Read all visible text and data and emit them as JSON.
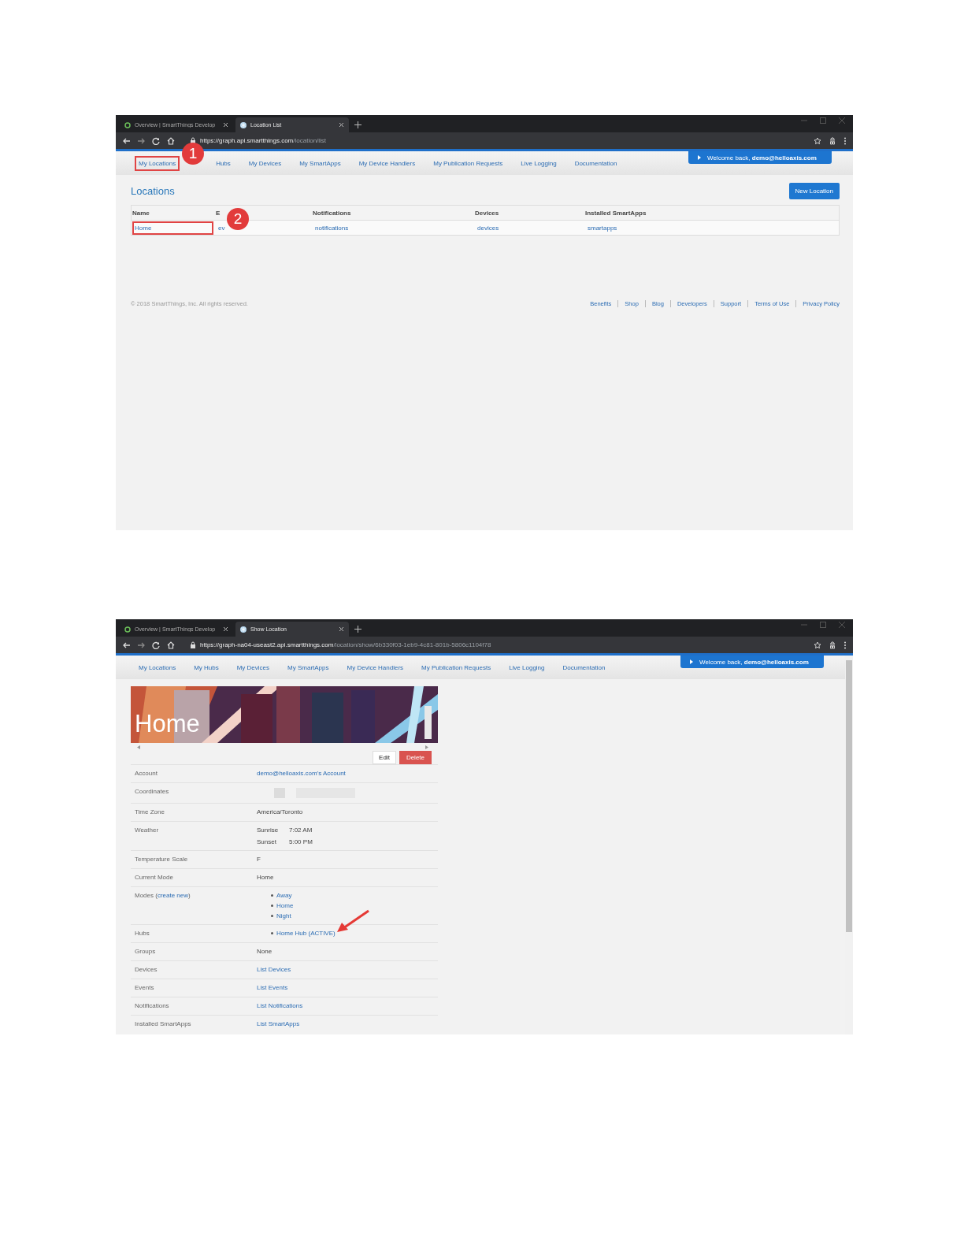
{
  "documents": [
    {
      "kind": "location_list",
      "tabs": [
        {
          "title": "Overview | SmartThings Develop",
          "kind": "loading",
          "selected": false
        },
        {
          "title": "Location List",
          "kind": "site",
          "selected": true
        }
      ],
      "url": {
        "host": "https://graph.api.smartthings.com",
        "path": "/location/list"
      },
      "nav": [
        {
          "label": "My Locations",
          "highlighted": true,
          "callout": "1"
        },
        {
          "label": "Hubs",
          "highlighted": false
        },
        {
          "label": "My Devices",
          "highlighted": false
        },
        {
          "label": "My SmartApps",
          "highlighted": false
        },
        {
          "label": "My Device Handlers",
          "highlighted": false
        },
        {
          "label": "My Publication Requests",
          "highlighted": false
        },
        {
          "label": "Live Logging",
          "highlighted": false
        },
        {
          "label": "Documentation",
          "highlighted": false
        }
      ],
      "welcome": "Welcome back, **demo@helloaxis.com**",
      "title": "Locations",
      "new_button": "New Location",
      "table": {
        "columns": [
          "Name",
          "E",
          "Notifications",
          "Devices",
          "Installed SmartApps"
        ],
        "rows": [
          {
            "cells": [
              {
                "text": "Home",
                "highlighted": true,
                "callout": "2"
              },
              {
                "text": "ev",
                "highlighted": false
              },
              {
                "text": "notifications",
                "highlighted": false
              },
              {
                "text": "devices",
                "highlighted": false
              },
              {
                "text": "smartapps",
                "highlighted": false
              }
            ]
          }
        ]
      },
      "footer": {
        "copyright": "© 2018 SmartThings, Inc. All rights reserved.",
        "links": [
          "Benefits",
          "Shop",
          "Blog",
          "Developers",
          "Support",
          "Terms of Use",
          "Privacy Policy"
        ]
      }
    },
    {
      "kind": "location_detail",
      "tabs": [
        {
          "title": "Overview | SmartThings Develop",
          "kind": "loading",
          "selected": false
        },
        {
          "title": "Show Location",
          "kind": "site",
          "selected": true
        }
      ],
      "url": {
        "host": "https://graph-na04-useast2.api.smartthings.com",
        "path": "/location/show/6b330f03-1eb9-4c81-801b-5806c1104f78"
      },
      "nav": [
        {
          "label": "My Locations"
        },
        {
          "label": "My Hubs"
        },
        {
          "label": "My Devices"
        },
        {
          "label": "My SmartApps"
        },
        {
          "label": "My Device Handlers"
        },
        {
          "label": "My Publication Requests"
        },
        {
          "label": "Live Logging"
        },
        {
          "label": "Documentation"
        }
      ],
      "welcome": "Welcome back, **demo@helloaxis.com**",
      "banner": {
        "kind": "picture",
        "title": "Home"
      },
      "buttons": {
        "edit": "Edit",
        "delete": "Delete"
      },
      "rows": [
        {
          "label": "Account",
          "kind": "link",
          "value": "demo@helloaxis.com's Account"
        },
        {
          "label": "Coordinates",
          "kind": "redacted"
        },
        {
          "label": "Time Zone",
          "kind": "text",
          "value": "America/Toronto"
        },
        {
          "label": "Weather",
          "kind": "pairs",
          "pairs": [
            {
              "name": "Sunrise",
              "value": "7:02 AM"
            },
            {
              "name": "Sunset",
              "value": "5:00 PM"
            }
          ]
        },
        {
          "label": "Temperature Scale",
          "kind": "text",
          "value": "F"
        },
        {
          "label": "Current Mode",
          "kind": "text",
          "value": "Home"
        },
        {
          "label": "Modes (",
          "label_link": "create new",
          "label_after": ")",
          "kind": "list",
          "items": [
            {
              "text": "Away",
              "pointer": false
            },
            {
              "text": "Home",
              "pointer": false
            },
            {
              "text": "Night",
              "pointer": false
            }
          ]
        },
        {
          "label": "Hubs",
          "kind": "list",
          "items": [
            {
              "text": "Home Hub (ACTIVE)",
              "pointer": true
            }
          ]
        },
        {
          "label": "Groups",
          "kind": "text",
          "value": "None"
        },
        {
          "label": "Devices",
          "kind": "link",
          "value": "List Devices"
        },
        {
          "label": "Events",
          "kind": "link",
          "value": "List Events"
        },
        {
          "label": "Notifications",
          "kind": "link",
          "value": "List Notifications"
        },
        {
          "label": "Installed SmartApps",
          "kind": "link",
          "value": "List SmartApps"
        }
      ]
    }
  ]
}
